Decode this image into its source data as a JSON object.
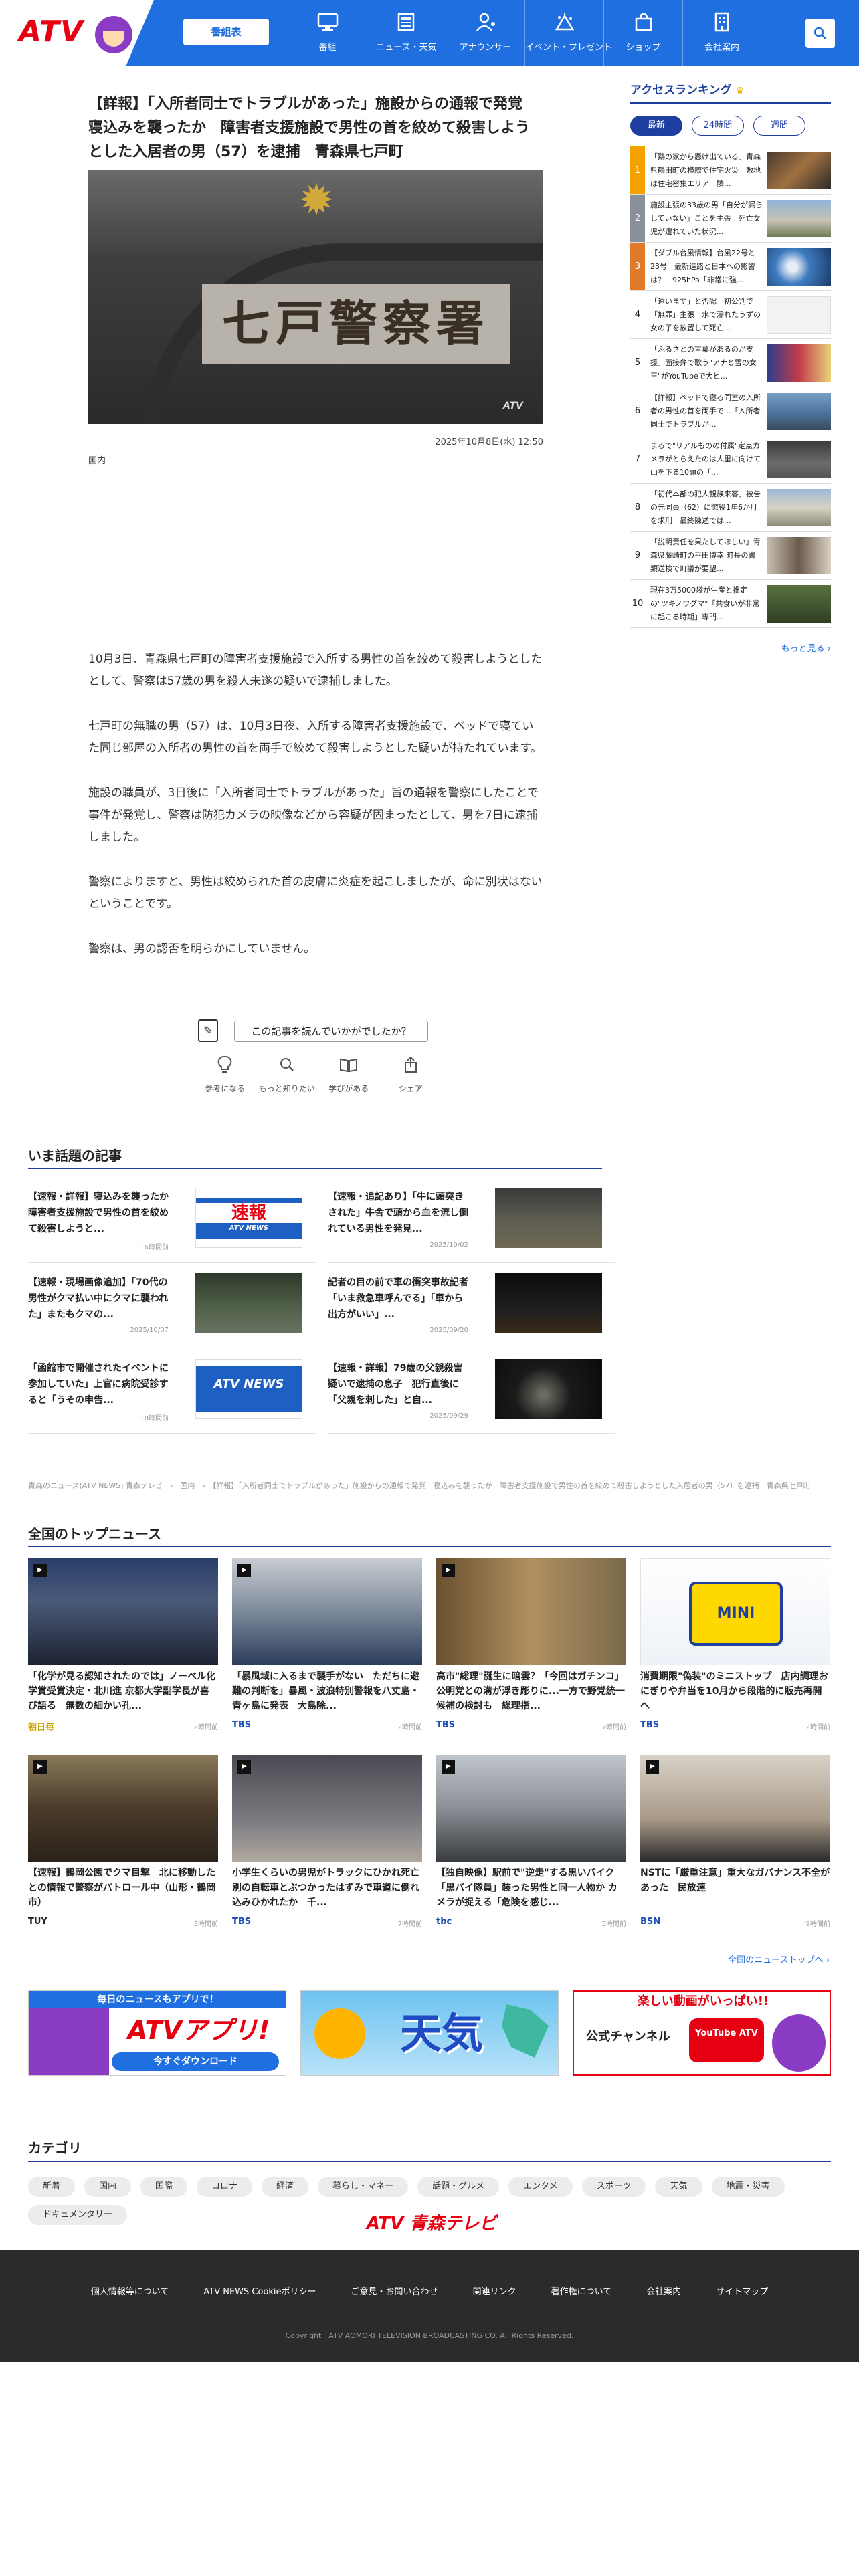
{
  "header": {
    "logo": "ATV",
    "schedule_label": "番組表",
    "nav": [
      {
        "label": "番組",
        "icon": "tv-icon"
      },
      {
        "label": "ニュース・天気",
        "icon": "newspaper-icon"
      },
      {
        "label": "アナウンサー",
        "icon": "announcer-icon"
      },
      {
        "label": "イベント・プレゼント",
        "icon": "event-icon"
      },
      {
        "label": "ショップ",
        "icon": "shop-icon"
      },
      {
        "label": "会社案内",
        "icon": "building-icon"
      }
    ],
    "search_icon": "search-icon"
  },
  "article": {
    "title": "【詳報】「入所者同士でトラブルがあった」施設からの通報で発覚　寝込みを襲ったか　障害者支援施設で男性の首を絞めて殺害しようとした入居者の男（57）を逮捕　青森県七戸町",
    "photo_sign": "七戸警察署",
    "photo_watermark": "ATV",
    "date": "2025年10月8日(水) 12:50",
    "category": "国内",
    "paragraphs": [
      "10月3日、青森県七戸町の障害者支援施設で入所する男性の首を絞めて殺害しようとしたとして、警察は57歳の男を殺人未遂の疑いで逮捕しました。",
      "七戸町の無職の男（57）は、10月3日夜、入所する障害者支援施設で、ベッドで寝ていた同じ部屋の入所者の男性の首を両手で絞めて殺害しようとした疑いが持たれています。",
      "施設の職員が、3日後に「入所者同士でトラブルがあった」旨の通報を警察にしたことで事件が発覚し、警察は防犯カメラの映像などから容疑が固まったとして、男を7日に逮捕しました。",
      "警察によりますと、男性は絞められた首の皮膚に炎症を起こしましたが、命に別状はないということです。",
      "警察は、男の認否を明らかにしていません。"
    ],
    "feedback_question": "この記事を読んでいかがでしたか？",
    "reactions": [
      "参考になる",
      "もっと知りたい",
      "学びがある",
      "シェア"
    ]
  },
  "ranking": {
    "title": "アクセスランキング",
    "tabs": [
      "最新",
      "24時間",
      "週間"
    ],
    "items": [
      {
        "num": "1",
        "text": "「鶏の家から懸け出ている」青森県鶴田町の横際で住宅火災　敷地は住宅密集エリア　隣..."
      },
      {
        "num": "2",
        "text": "施設主張の33歳の男「自分が漏らしていない」ことを主張　死亡女児が遭れていた状況..."
      },
      {
        "num": "3",
        "text": "【ダブル台風情報】台風22号と23号　最新進路と日本への影響は？　925hPa「非常に強..."
      },
      {
        "num": "4",
        "text": "「遠います」と否認　初公判で「無罪」主張　水で濡れたうずの女の子を放置して死亡..."
      },
      {
        "num": "5",
        "text": "「ふるさとの言葉があるのが支援」面接弁で歌う\"アナと雪の女王\"がYouTubeで大ヒ..."
      },
      {
        "num": "6",
        "text": "【詳報】ベッドで寝る同室の入所者の男性の首を両手で...「入所者同士でトラブルが..."
      },
      {
        "num": "7",
        "text": "まるで\"リアルものの付属\"定点カメラがとらえたのは人里に向けて山を下る10頭の「..."
      },
      {
        "num": "8",
        "text": "「初代本部の犯人親族来客」被告の元同員（62）に懲役1年6か月を求刑　最終陳述では..."
      },
      {
        "num": "9",
        "text": "「説明責任を果たしてほしい」青森県藤崎町の平田博幸 町長の書類送検で町議が要望..."
      },
      {
        "num": "10",
        "text": "現在3万5000袋が生産と推定の\"ツキノワグマ\"「共食いが非常に起こる時期」専門..."
      }
    ],
    "more": "もっと見る"
  },
  "trending": {
    "title": "いま話題の記事",
    "items": [
      {
        "text": "【速報・詳報】寝込みを襲ったか　障害者支援施設で男性の首を絞めて殺害しようと...",
        "date": "16時間前",
        "thumb": "速報"
      },
      {
        "text": "【速報・追記あり】「牛に頭突きされた」牛舎で頭から血を流し倒れている男性を発見...",
        "date": "2025/10/02",
        "thumb": ""
      },
      {
        "text": "【速報・現場画像追加】「70代の男性がクマ払い中にクマに襲われた」またもクマの...",
        "date": "2025/10/07",
        "thumb": ""
      },
      {
        "text": "記者の目の前で車の衝突事故記者「いま救急車呼んでる」「車から出方がいい」...",
        "date": "2025/09/20",
        "thumb": ""
      },
      {
        "text": "「函館市で開催されたイベントに参加していた」上官に病院受診すると「うその申告...",
        "date": "10時間前",
        "thumb": "ATV NEWS"
      },
      {
        "text": "【速報・詳報】79歳の父親殺害疑いで逮捕の息子　犯行直後に「父親を刺した」と自...",
        "date": "2025/09/29",
        "thumb": ""
      }
    ]
  },
  "breadcrumb": "青森のニュース(ATV NEWS) 青森テレビ　›　国内　›　【詳報】「入所者同士でトラブルがあった」施設からの通報で発覚　寝込みを襲ったか　障害者支援施設で男性の首を絞めて殺害しようとした入居者の男（57）を逮捕　青森県七戸町",
  "national": {
    "title": "全国のトップニュース",
    "items": [
      {
        "text": "「化学が見る認知されたのでは」ノーベル化学賞受賞決定・北川進 京都大学副学長が喜び語る　無数の細かい孔...",
        "source": "朝日毎",
        "date": "2時間前"
      },
      {
        "text": "「暴風域に入るまで襲手がない　ただちに避難の判断を」暴風・波浪特別警報を八丈島・青ヶ島に発表　大島除...",
        "source": "TBS",
        "date": "2時間前"
      },
      {
        "text": "高市\"総理\"誕生に暗雲？「今回はガチンコ」公明党との溝が浮き彫りに...一方で野党統一候補の検討も　総理指...",
        "source": "TBS",
        "date": "7時間前"
      },
      {
        "text": "消費期限\"偽装\"のミニストップ　店内調理おにぎりや弁当を10月から段階的に販売再開へ",
        "source": "TBS",
        "date": "2時間前"
      },
      {
        "text": "【速報】鶴岡公園でクマ目撃　北に移動したとの情報で警察がパトロール中（山形・鶴岡市）",
        "source": "TUY",
        "date": "3時間前"
      },
      {
        "text": "小学生くらいの男児がトラックにひかれ死亡　別の自転車とぶつかったはずみで車道に倒れ込みひかれたか　千...",
        "source": "TBS",
        "date": "7時間前"
      },
      {
        "text": "【独自映像】駅前で\"逆走\"する黒いバイク「黒バイ隊員」装った男性と同一人物か カメラが捉える「危険を感じ...",
        "source": "tbc",
        "date": "5時間前"
      },
      {
        "text": "NSTに「厳重注意」重大なガバナンス不全があった　民放連",
        "source": "BSN",
        "date": "9時間前"
      }
    ],
    "more": "全国のニューストップへ"
  },
  "banners": [
    {
      "top": "毎日のニュースもアプリで！",
      "main": "ATVアプリ!",
      "sub": "今すぐダウンロード"
    },
    {
      "main": "天気"
    },
    {
      "top": "楽しい動画がいっぱい!!",
      "main": "公式チャンネル",
      "sub": "YouTube ATV"
    }
  ],
  "categories": {
    "title": "カテゴリ",
    "items": [
      "新着",
      "国内",
      "国際",
      "コロナ",
      "経済",
      "暮らし・マネー",
      "話題・グルメ",
      "エンタメ",
      "スポーツ",
      "天気",
      "地震・災害",
      "ドキュメンタリー"
    ]
  },
  "footer": {
    "logo": "ATV 青森テレビ",
    "links": [
      "個人情報等について",
      "ATV NEWS Cookieポリシー",
      "ご意見・お問い合わせ",
      "関連リンク",
      "著作権について",
      "会社案内",
      "サイトマップ"
    ],
    "copyright": "Copyright　ATV AOMORI TELEVISION BROADCASTING CO. All Rights Reserved."
  },
  "colors": {
    "brand_blue": "#1f6fe0",
    "accent_red": "#e60012",
    "section_navy": "#1f3fa0"
  }
}
